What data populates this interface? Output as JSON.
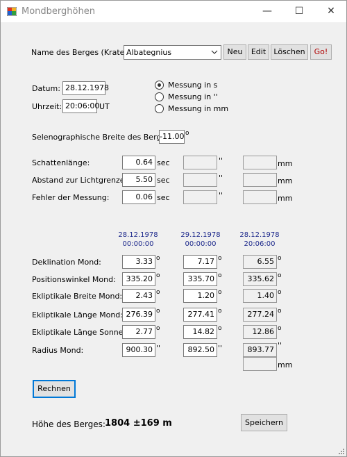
{
  "window": {
    "title": "Mondberghöhen",
    "min": "—",
    "max": "☐",
    "close": "✕"
  },
  "berg": {
    "label": "Name des Berges (Kraters):",
    "value": "Albategnius",
    "btn_neu": "Neu",
    "btn_edit": "Edit",
    "btn_loeschen": "Löschen",
    "btn_go": "Go!"
  },
  "datum": {
    "label": "Datum:",
    "value": "28.12.1978"
  },
  "uhrzeit": {
    "label": "Uhrzeit:",
    "value": "20:06:00",
    "unit": "UT"
  },
  "messung": {
    "s": "Messung in s",
    "arcsec": "Messung in ''",
    "mm": "Messung in mm",
    "selected": "s"
  },
  "breite": {
    "label": "Selenographische Breite des Berges:",
    "value": "-11.00",
    "unit": "o"
  },
  "rows1": [
    {
      "label": "Schattenlänge:",
      "value": "0.64",
      "unit1": "sec",
      "unit2": "''",
      "unit3": "mm"
    },
    {
      "label": "Abstand zur Lichtgrenze:",
      "value": "5.50",
      "unit1": "sec",
      "unit2": "''",
      "unit3": "mm"
    },
    {
      "label": "Fehler der Messung:",
      "value": "0.06",
      "unit1": "sec",
      "unit2": "''",
      "unit3": "mm"
    }
  ],
  "headers": [
    {
      "date": "28.12.1978",
      "time": "00:00:00"
    },
    {
      "date": "29.12.1978",
      "time": "00:00:00"
    },
    {
      "date": "28.12.1978",
      "time": "20:06:00"
    }
  ],
  "rows2": [
    {
      "label": "Deklination Mond:",
      "v1": "3.33",
      "v2": "7.17",
      "v3": "6.55",
      "unit": "o"
    },
    {
      "label": "Positionswinkel Mond:",
      "v1": "335.20",
      "v2": "335.70",
      "v3": "335.62",
      "unit": "o"
    },
    {
      "label": "Ekliptikale Breite Mond:",
      "v1": "2.43",
      "v2": "1.20",
      "v3": "1.40",
      "unit": "o"
    },
    {
      "label": "Ekliptikale Länge Mond:",
      "v1": "276.39",
      "v2": "277.41",
      "v3": "277.24",
      "unit": "o"
    },
    {
      "label": "Ekliptikale Länge Sonne:",
      "v1": "2.77",
      "v2": "14.82",
      "v3": "12.86",
      "unit": "o"
    },
    {
      "label": "Radius Mond:",
      "v1": "900.30",
      "v2": "892.50",
      "v3": "893.77",
      "unit": "''"
    }
  ],
  "radius_mm_unit": "mm",
  "btn_rechnen": "Rechnen",
  "btn_speichern": "Speichern",
  "result": {
    "label": "Höhe des Berges:",
    "value": "1804 ±169 m"
  }
}
